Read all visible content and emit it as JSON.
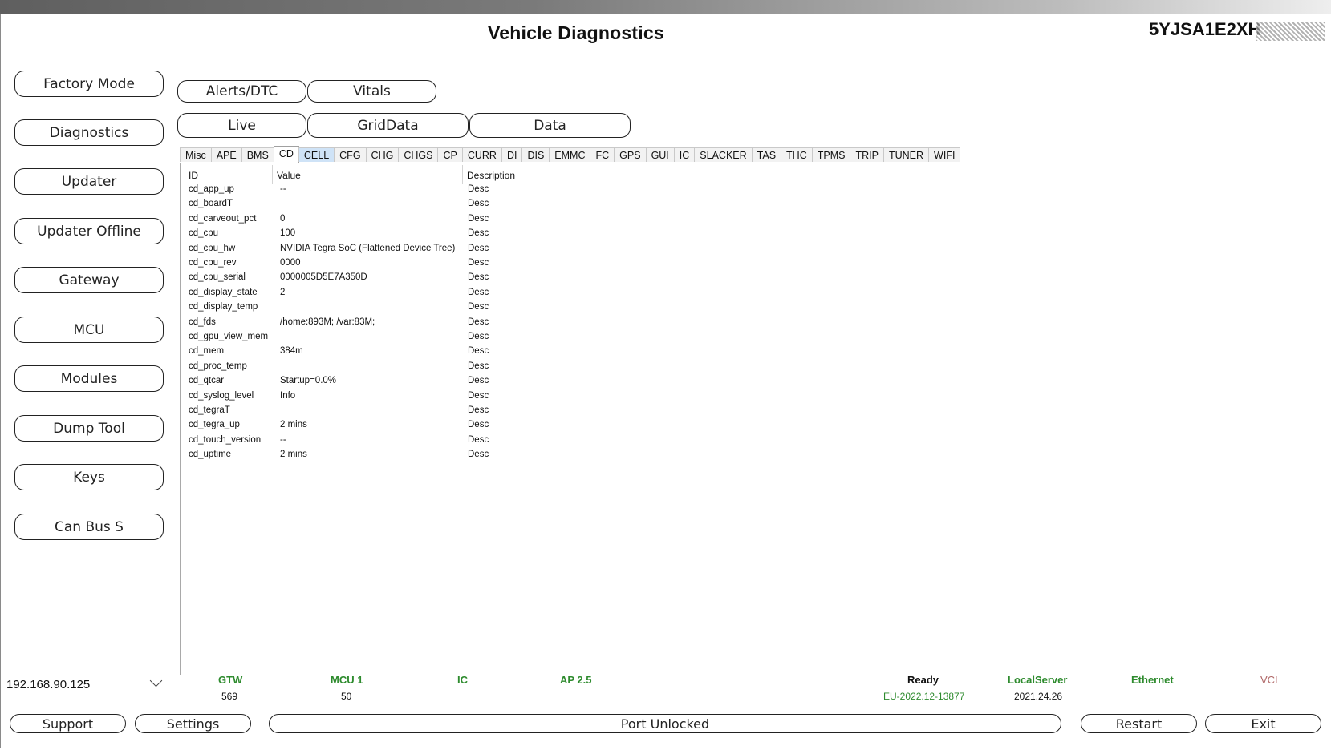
{
  "window": {
    "title": "Vehicle Diagnostics",
    "vin": "5YJSA1E2XH"
  },
  "sidebar": {
    "items": [
      {
        "label": "Factory Mode"
      },
      {
        "label": "Diagnostics"
      },
      {
        "label": "Updater"
      },
      {
        "label": "Updater Offline"
      },
      {
        "label": "Gateway"
      },
      {
        "label": "MCU"
      },
      {
        "label": "Modules"
      },
      {
        "label": "Dump Tool"
      },
      {
        "label": "Keys"
      },
      {
        "label": "Can Bus S"
      }
    ]
  },
  "top_tabs": {
    "row1": [
      "Alerts/DTC",
      "Vitals"
    ],
    "row2": [
      "Live",
      "GridData",
      "Data"
    ]
  },
  "subtabs": {
    "items": [
      "Misc",
      "APE",
      "BMS",
      "CD",
      "CELL",
      "CFG",
      "CHG",
      "CHGS",
      "CP",
      "CURR",
      "DI",
      "DIS",
      "EMMC",
      "FC",
      "GPS",
      "GUI",
      "IC",
      "SLACKER",
      "TAS",
      "THC",
      "TPMS",
      "TRIP",
      "TUNER",
      "WIFI"
    ],
    "active": "CD",
    "highlighted": "CELL"
  },
  "table": {
    "headers": {
      "id": "ID",
      "value": "Value",
      "description": "Description"
    },
    "rows": [
      {
        "id": "cd_app_up",
        "value": "--",
        "desc": "Desc"
      },
      {
        "id": "cd_boardT",
        "value": "",
        "desc": "Desc"
      },
      {
        "id": "cd_carveout_pct",
        "value": "0",
        "desc": "Desc"
      },
      {
        "id": "cd_cpu",
        "value": "100",
        "desc": "Desc"
      },
      {
        "id": "cd_cpu_hw",
        "value": "NVIDIA Tegra SoC (Flattened Device Tree)",
        "desc": "Desc"
      },
      {
        "id": "cd_cpu_rev",
        "value": "0000",
        "desc": "Desc"
      },
      {
        "id": "cd_cpu_serial",
        "value": "0000005D5E7A350D",
        "desc": "Desc"
      },
      {
        "id": "cd_display_state",
        "value": "2",
        "desc": "Desc"
      },
      {
        "id": "cd_display_temp",
        "value": "",
        "desc": "Desc"
      },
      {
        "id": "cd_fds",
        "value": "/home:893M; /var:83M;",
        "desc": "Desc"
      },
      {
        "id": "cd_gpu_view_mem",
        "value": "",
        "desc": "Desc"
      },
      {
        "id": "cd_mem",
        "value": "384m",
        "desc": "Desc"
      },
      {
        "id": "cd_proc_temp",
        "value": "",
        "desc": "Desc"
      },
      {
        "id": "cd_qtcar",
        "value": "Startup=0.0%",
        "desc": "Desc"
      },
      {
        "id": "cd_syslog_level",
        "value": "Info",
        "desc": "Desc"
      },
      {
        "id": "cd_tegraT",
        "value": "",
        "desc": "Desc"
      },
      {
        "id": "cd_tegra_up",
        "value": "2 mins",
        "desc": "Desc"
      },
      {
        "id": "cd_touch_version",
        "value": "--",
        "desc": "Desc"
      },
      {
        "id": "cd_uptime",
        "value": "2 mins",
        "desc": "Desc"
      }
    ]
  },
  "connection": {
    "ip": "192.168.90.125"
  },
  "status": {
    "gtw": {
      "label": "GTW",
      "value": "569"
    },
    "mcu": {
      "label": "MCU 1",
      "value": "50"
    },
    "ic": {
      "label": "IC"
    },
    "ap": {
      "label": "AP 2.5"
    },
    "ready": {
      "label": "Ready",
      "value": "EU-2022.12-13877"
    },
    "local_server": {
      "label": "LocalServer",
      "value": "2021.24.26"
    },
    "ethernet": {
      "label": "Ethernet"
    },
    "vci": {
      "label": "VCI"
    }
  },
  "colors": {
    "status_ok": "#2e8b2e",
    "status_vci": "#b06868",
    "tab_highlight": "#cfe3f7"
  },
  "bottom": {
    "support": "Support",
    "settings": "Settings",
    "port_status": "Port Unlocked",
    "restart": "Restart",
    "exit": "Exit"
  }
}
